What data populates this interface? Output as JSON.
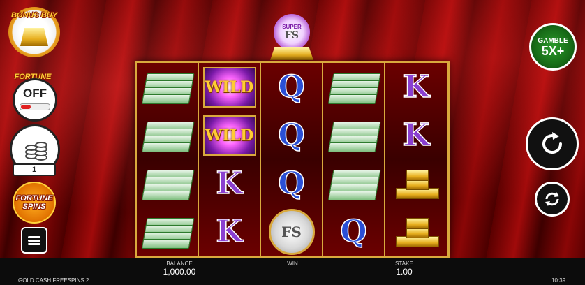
{
  "buttons": {
    "bonus_buy": "BONUS BUY",
    "fortune_bet_title": "FORTUNE BET",
    "fortune_bet_state": "OFF",
    "coins_value": "1",
    "fortune_spins_line1": "FORTUNE",
    "fortune_spins_line2": "SPINS",
    "gamble_line1": "GAMBLE",
    "gamble_line2": "5X+"
  },
  "top_badge": {
    "super": "SUPER",
    "fs": "FS"
  },
  "reels": [
    [
      "cash",
      "cash",
      "cash",
      "cash"
    ],
    [
      "wild",
      "wild",
      "k",
      "k"
    ],
    [
      "q",
      "q",
      "q",
      "fs"
    ],
    [
      "cash",
      "cash",
      "cash",
      "q"
    ],
    [
      "k",
      "k",
      "gold",
      "gold"
    ]
  ],
  "symbols": {
    "wild": "WILD",
    "q": "Q",
    "k": "K",
    "fs": "FS"
  },
  "bottom_bar": {
    "game_name": "GOLD CASH FREESPINS 2",
    "balance_label": "BALANCE",
    "balance_value": "1,000.00",
    "win_label": "WIN",
    "stake_label": "STAKE",
    "stake_value": "1.00",
    "clock": "10:39"
  },
  "icons": [
    "gold-bar-icon",
    "coin-stack-icon",
    "menu-icon",
    "spin-icon",
    "autoplay-icon"
  ]
}
